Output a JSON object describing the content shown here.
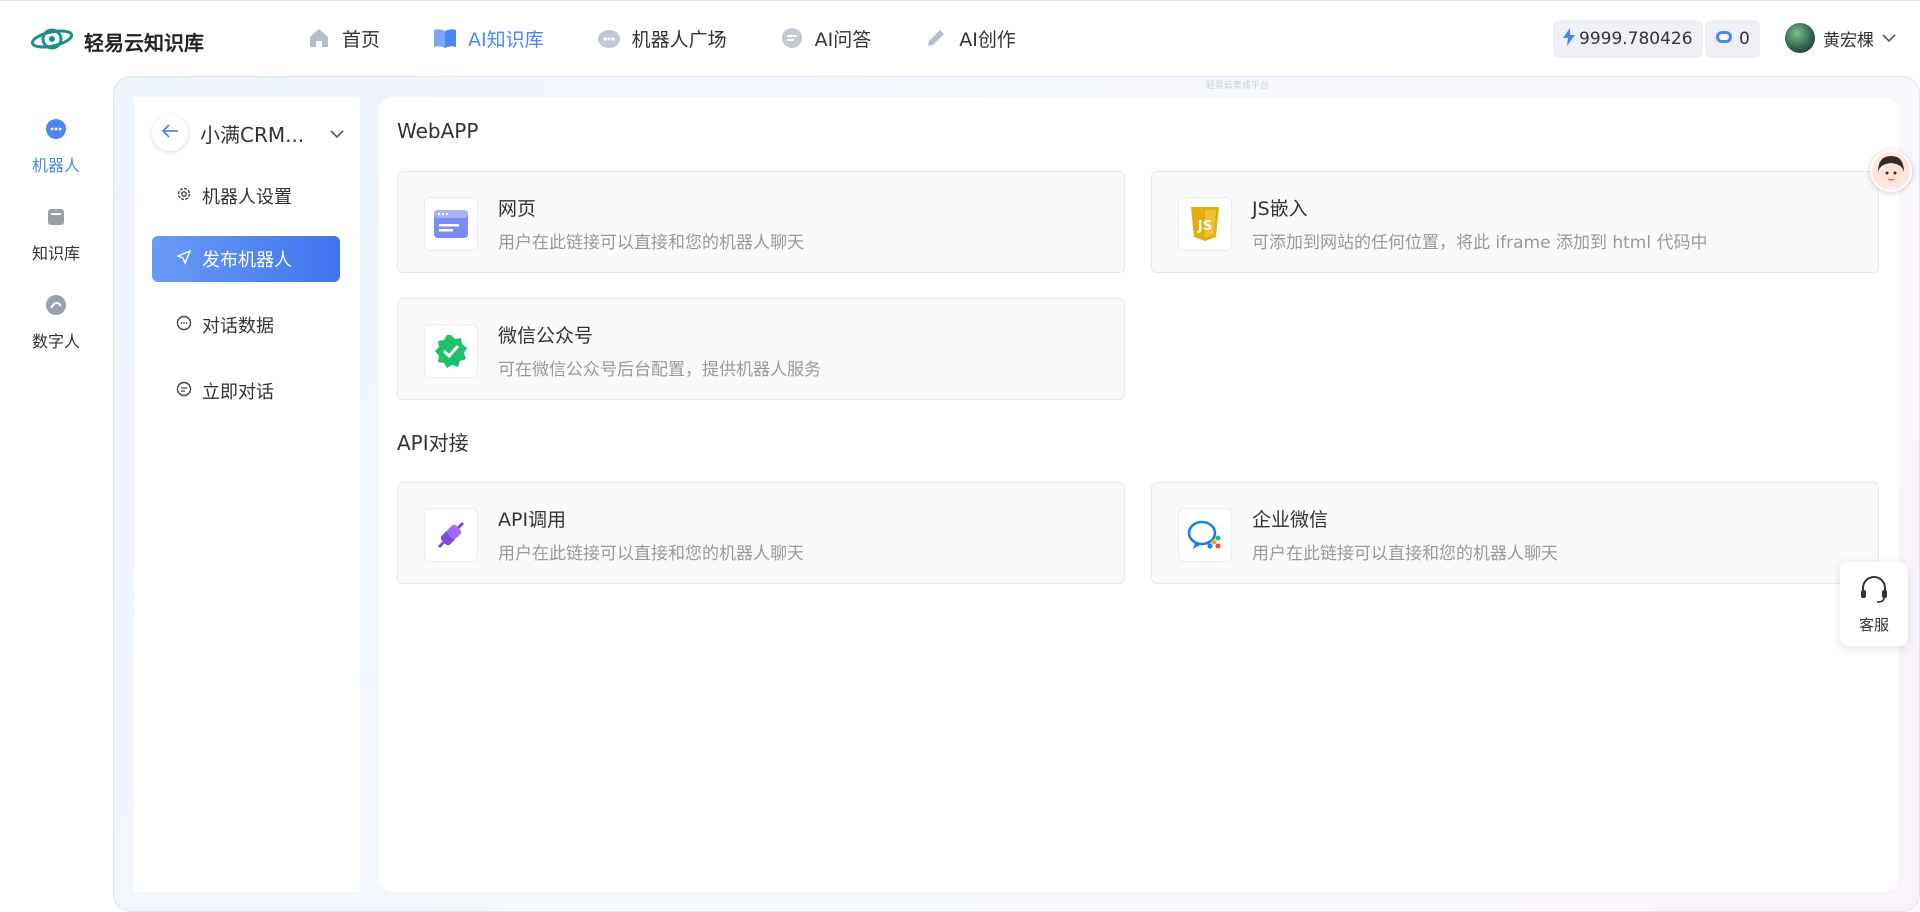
{
  "app": {
    "logo_text": "轻易云知识库",
    "watermark": "轻易云集成平台"
  },
  "nav": [
    {
      "label": "首页",
      "icon": "home-icon"
    },
    {
      "label": "AI知识库",
      "icon": "book-icon",
      "active": true
    },
    {
      "label": "机器人广场",
      "icon": "robot-icon"
    },
    {
      "label": "AI问答",
      "icon": "chat-icon"
    },
    {
      "label": "AI创作",
      "icon": "pen-icon"
    }
  ],
  "account": {
    "balance": "9999.780426",
    "tokens": "0",
    "user_name": "黄宏棵"
  },
  "rail": [
    {
      "label": "机器人",
      "icon": "robot-icon",
      "active": true
    },
    {
      "label": "知识库",
      "icon": "database-icon"
    },
    {
      "label": "数字人",
      "icon": "digital-human-icon"
    }
  ],
  "submenu": {
    "bot_name": "小满CRM...",
    "items": [
      {
        "label": "机器人设置",
        "icon": "gear-icon"
      },
      {
        "label": "发布机器人",
        "icon": "send-icon",
        "active": true
      },
      {
        "label": "对话数据",
        "icon": "message-icon"
      },
      {
        "label": "立即对话",
        "icon": "chat-bubble-icon"
      }
    ]
  },
  "sections": {
    "webapp": {
      "title": "WebAPP",
      "cards": [
        {
          "title": "网页",
          "desc": "用户在此链接可以直接和您的机器人聊天",
          "icon": "webpage-icon"
        },
        {
          "title": "JS嵌入",
          "desc": "可添加到网站的任何位置，将此 iframe 添加到 html 代码中",
          "icon": "js-icon"
        },
        {
          "title": "微信公众号",
          "desc": "可在微信公众号后台配置，提供机器人服务",
          "icon": "wechat-official-icon"
        }
      ]
    },
    "api": {
      "title": "API对接",
      "cards": [
        {
          "title": "API调用",
          "desc": "用户在此链接可以直接和您的机器人聊天",
          "icon": "plug-icon"
        },
        {
          "title": "企业微信",
          "desc": "用户在此链接可以直接和您的机器人聊天",
          "icon": "wecom-icon"
        }
      ]
    }
  },
  "service": {
    "label": "客服"
  },
  "colors": {
    "accent": "#4d86f4",
    "card_bg": "#fafafa",
    "muted_text": "#999999"
  }
}
